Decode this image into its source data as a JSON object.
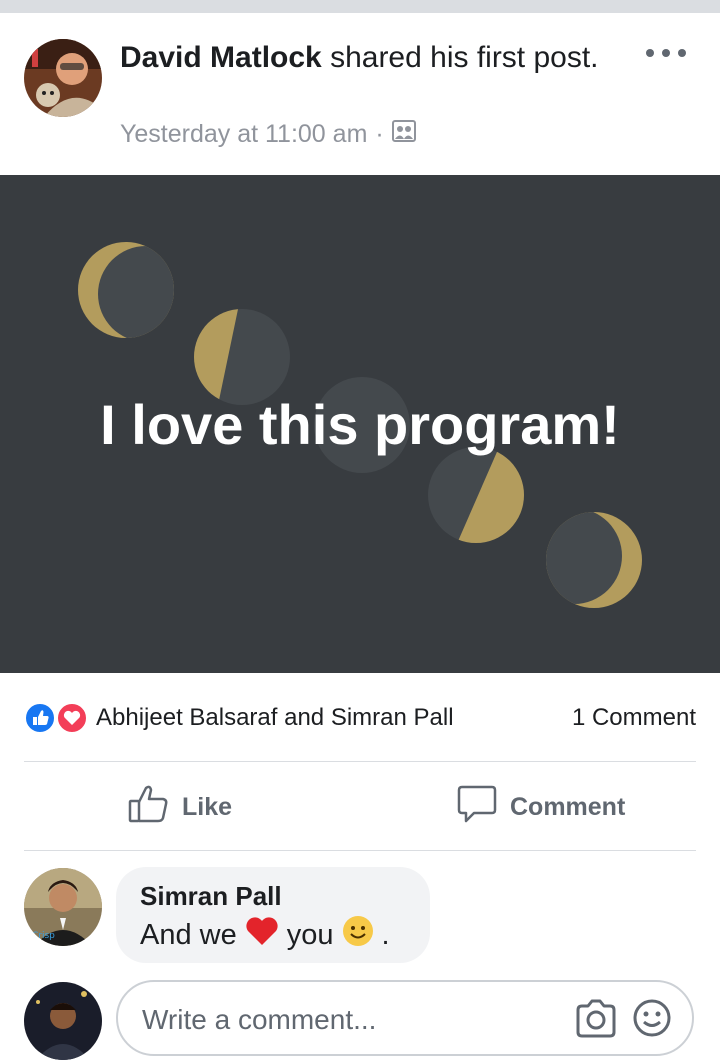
{
  "post": {
    "author": "David Matlock",
    "action": " shared his first post.",
    "timestamp": "Yesterday at 11:00 am",
    "separator": "·",
    "privacy_icon": "group-photo-icon",
    "text": "I love this program!",
    "background_color": "#383c40",
    "accent_color": "#b39c5d"
  },
  "reactions": {
    "icons": [
      "like-reaction-icon",
      "love-reaction-icon"
    ],
    "names": "Abhijeet Balsaraf and Simran Pall",
    "comment_count": "1 Comment"
  },
  "actions": {
    "like_label": "Like",
    "comment_label": "Comment"
  },
  "comment": {
    "author": "Simran Pall",
    "text_before": "And we",
    "text_after": "you",
    "text_end": "."
  },
  "composer": {
    "placeholder": "Write a comment..."
  },
  "colors": {
    "like_blue": "#1877f2",
    "love_red": "#f33e58",
    "meta_gray": "#90949c"
  }
}
